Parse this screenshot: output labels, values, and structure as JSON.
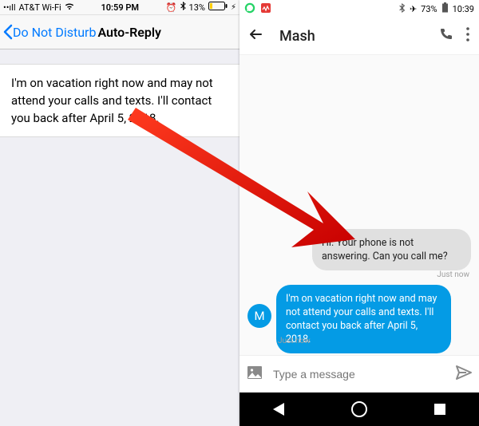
{
  "ios": {
    "status": {
      "carrier": "AT&T Wi-Fi",
      "time": "10:59 PM",
      "battery": "13%"
    },
    "back_label": "Do Not Disturb",
    "title": "Auto-Reply",
    "message": "I'm on vacation right now and may not attend your calls and texts. I'll contact you back after April 5, 2018."
  },
  "android": {
    "status": {
      "battery": "73%",
      "time": "10:39"
    },
    "title": "Mash",
    "incoming": {
      "text": "Hi. Your phone is not answering. Can you call me?",
      "ts": "Just now"
    },
    "outgoing": {
      "avatar": "M",
      "text": "I'm on vacation right now and may not attend your calls and texts. I'll contact you back after April 5, 2018.",
      "ts": "Just now"
    },
    "compose": {
      "placeholder": "Type a message"
    }
  }
}
